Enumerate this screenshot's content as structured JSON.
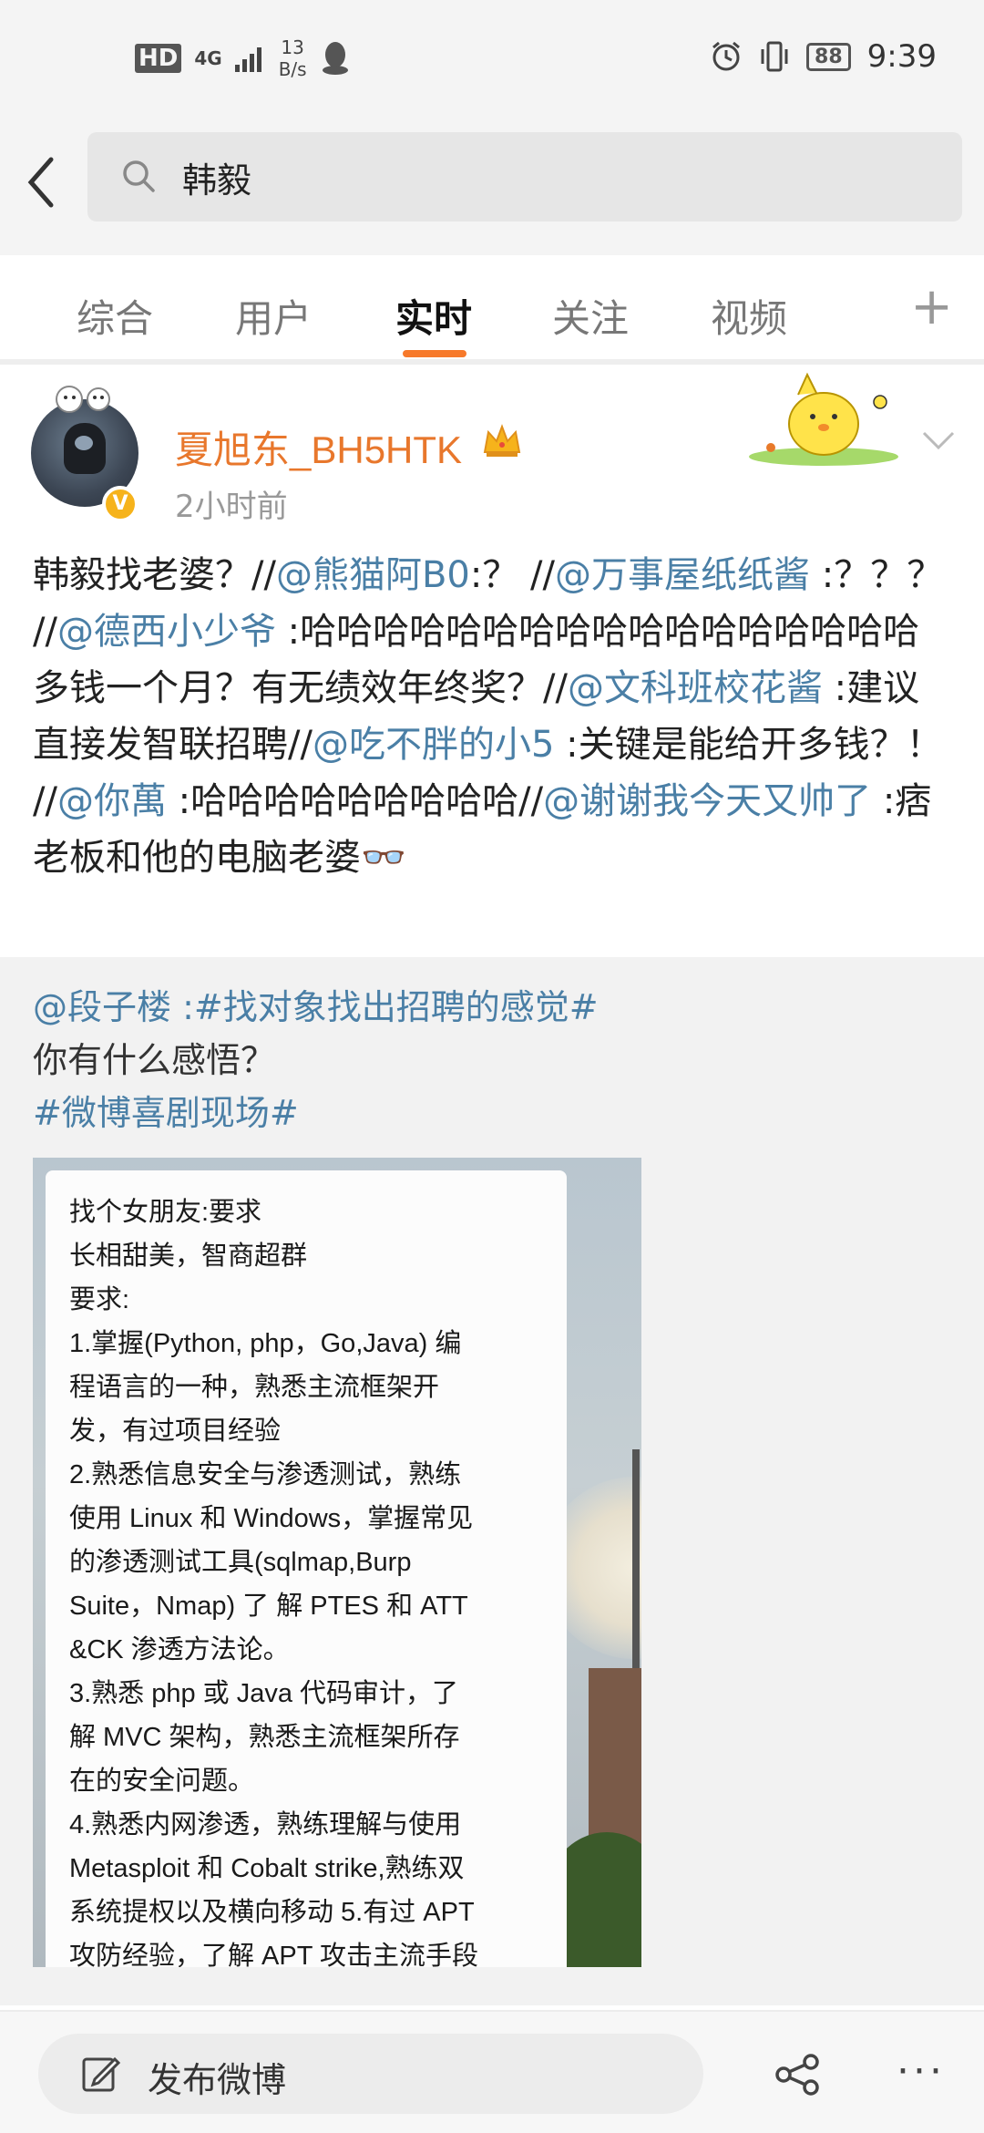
{
  "status_bar": {
    "hd": "HD",
    "network": "4G",
    "speed_value": "13",
    "speed_unit": "B/s",
    "battery": "88",
    "time": "9:39",
    "icons": [
      "qq-icon",
      "alarm-icon",
      "vibrate-icon",
      "battery-icon"
    ]
  },
  "search": {
    "query": "韩毅"
  },
  "tabs": [
    {
      "label": "综合",
      "active": false
    },
    {
      "label": "用户",
      "active": false
    },
    {
      "label": "实时",
      "active": true
    },
    {
      "label": "关注",
      "active": false
    },
    {
      "label": "视频",
      "active": false
    }
  ],
  "tabs_plus": "+",
  "post": {
    "username": "夏旭东_BH5HTK",
    "time": "2小时前",
    "segments": [
      {
        "text": "韩毅找老婆？//",
        "mention": false
      },
      {
        "text": "@熊猫阿B0",
        "mention": true
      },
      {
        "text": ":？ //",
        "mention": false
      },
      {
        "text": "@万事屋纸纸酱",
        "mention": true
      },
      {
        "text": " :？？？ //",
        "mention": false
      },
      {
        "text": "@德西小少爷",
        "mention": true
      },
      {
        "text": " :哈哈哈哈哈哈哈哈哈哈哈哈哈哈哈哈哈多钱一个月？有无绩效年终奖？//",
        "mention": false
      },
      {
        "text": "@文科班校花酱",
        "mention": true
      },
      {
        "text": " :建议直接发智联招聘//",
        "mention": false
      },
      {
        "text": "@吃不胖的小5",
        "mention": true
      },
      {
        "text": " :关键是能给开多钱？！ //",
        "mention": false
      },
      {
        "text": "@你萬",
        "mention": true
      },
      {
        "text": " :哈哈哈哈哈哈哈哈哈//",
        "mention": false
      },
      {
        "text": "@谢谢我今天又帅了",
        "mention": true
      },
      {
        "text": " :痞老板和他的电脑老婆",
        "mention": false
      },
      {
        "text": "👓",
        "mention": false
      }
    ]
  },
  "retweet": {
    "line1_mention": "@段子楼",
    "line1_sep": " :",
    "line1_tag": "#找对象找出招聘的感觉#",
    "line2": "你有什么感悟？",
    "line3_tag": "#微博喜剧现场#",
    "image_text": [
      "找个女朋友:要求",
      "长相甜美，智商超群",
      "要求:",
      "1.掌握(Python, php，Go,Java) 编",
      "程语言的一种，熟悉主流框架开",
      "发，有过项目经验",
      "2.熟悉信息安全与渗透测试，熟练",
      "使用 Linux 和 Windows，掌握常见",
      "的渗透测试工具(sqlmap,Burp",
      "Suite，Nmap) 了 解 PTES 和 ATT",
      "&CK 渗透方法论。",
      "3.熟悉 php 或 Java 代码审计，了",
      "解 MVC 架构，熟悉主流框架所存",
      "在的安全问题。",
      "4.熟悉内网渗透，熟练理解与使用",
      "Metasploit 和 Cobalt strike,熟练双",
      "系统提权以及横向移动 5.有过 APT",
      "攻防经验，了解 APT 攻击主流手段"
    ]
  },
  "bottom_bar": {
    "compose_label": "发布微博",
    "more": "···"
  },
  "colors": {
    "accent_orange": "#f7792a",
    "username_orange": "#e8772c",
    "mention_blue": "#4a7fa6",
    "badge_gold": "#f6b31b"
  }
}
